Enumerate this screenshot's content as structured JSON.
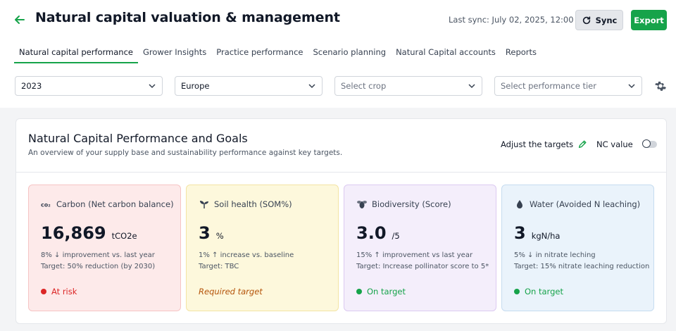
{
  "header": {
    "title": "Natural capital valuation & management",
    "last_sync": "Last sync: July 02, 2025, 12:00",
    "sync_label": "Sync",
    "export_label": "Export"
  },
  "tabs": [
    {
      "label": "Natural capital performance",
      "active": true
    },
    {
      "label": "Grower Insights"
    },
    {
      "label": "Practice performance"
    },
    {
      "label": "Scenario planning"
    },
    {
      "label": "Natural Capital accounts"
    },
    {
      "label": "Reports"
    }
  ],
  "filters": {
    "year": "2023",
    "region": "Europe",
    "crop_placeholder": "Select crop",
    "tier_placeholder": "Select performance tier"
  },
  "panel": {
    "title": "Natural Capital Performance and Goals",
    "subtitle": "An overview of your supply base and sustainability performance against key targets.",
    "adjust_label": "Adjust the targets",
    "nc_value_label": "NC value"
  },
  "cards": [
    {
      "title": "Carbon (Net carbon balance)",
      "icon": "co2-icon",
      "value": "16,869",
      "unit": "tCO2e",
      "change": "8% ↓  improvement vs. last year",
      "target": "Target: 50% reduction (by 2030)",
      "status": "At risk",
      "status_color": "#dc2626"
    },
    {
      "title": "Soil health (SOM%)",
      "icon": "sprout-icon",
      "value": "3",
      "unit": "%",
      "change": "1% ↑  increase vs. baseline",
      "target": "Target: TBC",
      "status": "Required target",
      "status_color": "#b45309"
    },
    {
      "title": "Biodiversity (Score)",
      "icon": "bee-icon",
      "value": "3.0",
      "unit": "/5",
      "change": "15% ↑  improvement vs last year",
      "target": "Target: Increase pollinator score to 5*",
      "status": "On target",
      "status_color": "#16a34a"
    },
    {
      "title": "Water (Avoided N leaching)",
      "icon": "water-drop-icon",
      "value": "3",
      "unit": "kgN/ha",
      "change": "5% ↓  in nitrate leching",
      "target": "Target: 15% nitrate leaching reduction",
      "status": "On target",
      "status_color": "#16a34a"
    }
  ],
  "colors": {
    "accent": "#16a34a"
  }
}
